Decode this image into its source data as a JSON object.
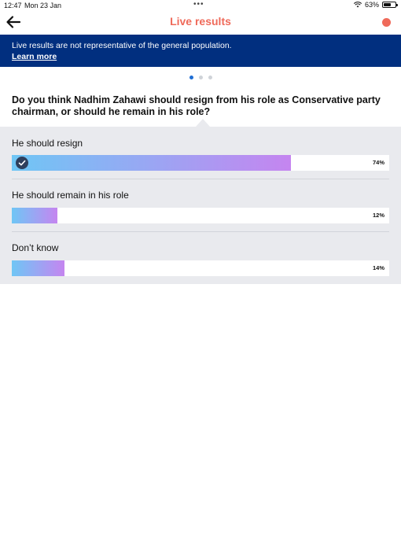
{
  "status": {
    "time": "12:47",
    "date": "Mon 23 Jan",
    "battery": "63%",
    "battery_level": 0.63
  },
  "nav": {
    "title": "Live results",
    "back_icon": "arrow-left-icon",
    "record_icon": "record-dot-icon",
    "accent": "#ef6a5a"
  },
  "banner": {
    "text": "Live results are not representative of the general population.",
    "link": "Learn more",
    "background": "#012f7f"
  },
  "pager": {
    "count": 3,
    "active": 0
  },
  "poll": {
    "question": "Do you think Nadhim Zahawi should resign from his role as Conservative party chairman, or should he remain in his role?",
    "options": [
      {
        "label": "He should resign",
        "percent_label": "74%",
        "fraction": 0.74,
        "selected": true
      },
      {
        "label": "He should remain in his role",
        "percent_label": "12%",
        "fraction": 0.12,
        "selected": false
      },
      {
        "label": "Don’t know",
        "percent_label": "14%",
        "fraction": 0.14,
        "selected": false
      }
    ]
  }
}
